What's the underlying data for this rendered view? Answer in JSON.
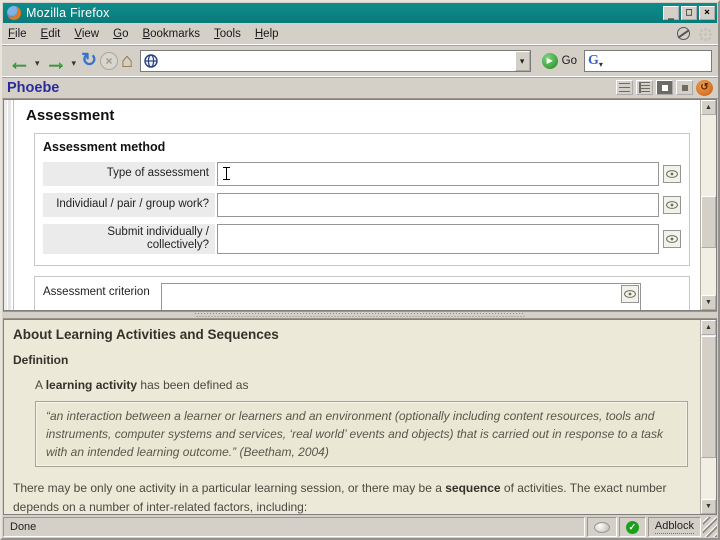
{
  "window": {
    "title": "Mozilla Firefox",
    "controls": {
      "minimize": "_",
      "maximize": "□",
      "close": "×"
    }
  },
  "menubar": {
    "items": [
      "File",
      "Edit",
      "View",
      "Go",
      "Bookmarks",
      "Tools",
      "Help"
    ]
  },
  "navbar": {
    "url_value": "",
    "search_value": "",
    "go_label": "Go"
  },
  "appbar": {
    "title": "Phoebe"
  },
  "form": {
    "heading": "Assessment",
    "section_title": "Assessment method",
    "fields": [
      {
        "label": "Type of assessment",
        "value": ""
      },
      {
        "label": "Individiaul / pair / group work?",
        "value": ""
      },
      {
        "label": "Submit individually / collectively?",
        "value": ""
      },
      {
        "label": "Assessment criterion",
        "value": ""
      }
    ]
  },
  "help": {
    "title": "About Learning Activities and Sequences",
    "subtitle": "Definition",
    "def_prefix": "A ",
    "def_term": "learning activity",
    "def_suffix": " has been defined as",
    "quote": "“an interaction between a learner or learners and an environment (optionally including content resources, tools and instruments, computer systems and services, ‘real world’ events and objects) that is carried out in response to a task with an intended learning outcome.” (Beetham, 2004)",
    "para_prefix": "There may be only one activity in a particular learning session, or there may be a ",
    "para_term": "sequence",
    "para_suffix": " of activities. The exact number depends on a number of inter-related factors, including:"
  },
  "statusbar": {
    "status": "Done",
    "adblock_label": "Adblock"
  },
  "icons": {
    "back": "←",
    "forward": "→",
    "dropdown": "▾",
    "reload": "↻",
    "stop": "×",
    "home": "⌂",
    "go_arrow": "▶",
    "google_g": "G",
    "sync": "↺",
    "scroll_up": "▲",
    "scroll_down": "▼",
    "check": "✓"
  },
  "colors": {
    "titlebar_teal": "#0f8c8c",
    "chrome_gray": "#d4d0c8",
    "panel_beige": "#ece9d8",
    "phoebe_blue": "#2b2b9c",
    "go_green": "#1d8a1d",
    "check_green": "#1ba01b"
  }
}
